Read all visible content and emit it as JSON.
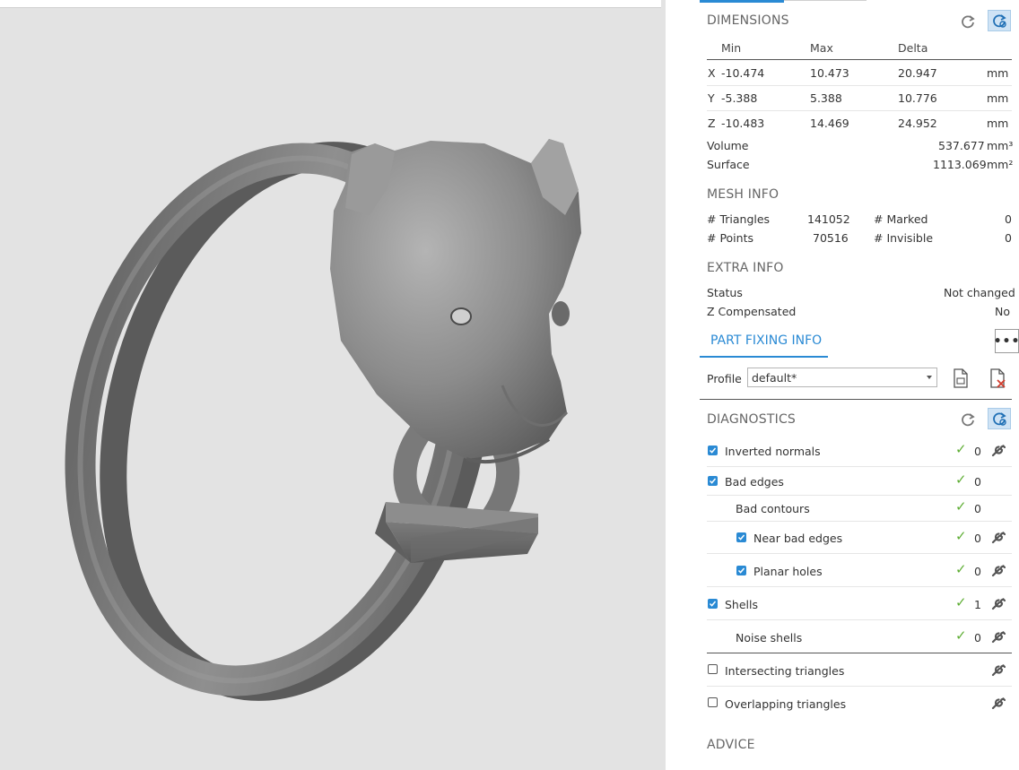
{
  "dimensions": {
    "title": "DIMENSIONS",
    "headers": [
      "Min",
      "Max",
      "Delta"
    ],
    "rows": [
      {
        "axis": "X",
        "min": "-10.474",
        "max": "10.473",
        "delta": "20.947",
        "unit": "mm"
      },
      {
        "axis": "Y",
        "min": "-5.388",
        "max": "5.388",
        "delta": "10.776",
        "unit": "mm"
      },
      {
        "axis": "Z",
        "min": "-10.483",
        "max": "14.469",
        "delta": "24.952",
        "unit": "mm"
      }
    ],
    "volume_label": "Volume",
    "volume_value": "537.677",
    "volume_unit": "mm³",
    "surface_label": "Surface",
    "surface_value": "1113.069",
    "surface_unit": "mm²"
  },
  "mesh_info": {
    "title": "MESH INFO",
    "triangles_label": "# Triangles",
    "triangles_value": "141052",
    "marked_label": "# Marked",
    "marked_value": "0",
    "points_label": "# Points",
    "points_value": "70516",
    "invisible_label": "# Invisible",
    "invisible_value": "0"
  },
  "extra_info": {
    "title": "EXTRA INFO",
    "status_label": "Status",
    "status_value": "Not changed",
    "zcomp_label": "Z Compensated",
    "zcomp_value": "No"
  },
  "part_fixing": {
    "tab_label": "PART FIXING INFO",
    "more_label": "•••",
    "profile_label": "Profile",
    "profile_value": "default*"
  },
  "diagnostics": {
    "title": "DIAGNOSTICS",
    "items": [
      {
        "label": "Inverted normals",
        "count": "0"
      },
      {
        "label": "Bad edges",
        "count": "0"
      },
      {
        "label": "Bad contours",
        "count": "0"
      },
      {
        "label": "Near bad edges",
        "count": "0"
      },
      {
        "label": "Planar holes",
        "count": "0"
      },
      {
        "label": "Shells",
        "count": "1"
      },
      {
        "label": "Noise shells",
        "count": "0"
      },
      {
        "label": "Intersecting triangles"
      },
      {
        "label": "Overlapping triangles"
      }
    ]
  },
  "advice": {
    "title": "ADVICE"
  },
  "icons": {
    "refresh": "refresh-icon",
    "auto_refresh": "auto-refresh-icon",
    "wrench": "wrench-icon",
    "profile_doc": "document-icon",
    "profile_delete": "delete-document-icon",
    "check": "checkmark-icon"
  },
  "colors": {
    "accent": "#2a8ad4",
    "check_green": "#5fae35",
    "viewport_bg": "#e3e3e3",
    "model_gray": "#8a8a8a"
  }
}
